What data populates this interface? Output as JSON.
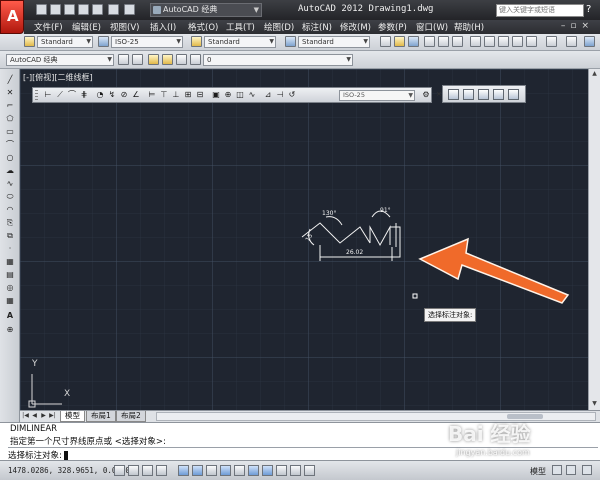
{
  "titlebar": {
    "workspace": "AutoCAD 经典",
    "app_title": "AutoCAD 2012   Drawing1.dwg",
    "search_placeholder": "键入关键字或短语"
  },
  "menu": [
    "文件(F)",
    "编辑(E)",
    "视图(V)",
    "插入(I)",
    "格式(O)",
    "工具(T)",
    "绘图(D)",
    "标注(N)",
    "修改(M)",
    "参数(P)",
    "窗口(W)",
    "帮助(H)"
  ],
  "toolbar_row1": {
    "text_style": "Standard",
    "dim_style": "ISO-25",
    "table_style": "Standard",
    "multileader_style": "Standard"
  },
  "toolbar_row2": {
    "workspace": "AutoCAD 经典",
    "layer": "0"
  },
  "viewport": {
    "label": "[-][俯视][二维线框]",
    "dimstyle_select": "ISO-25"
  },
  "drawing": {
    "dim_angle_left": "130°",
    "dim_angle_right": "91°",
    "dim_left_small": "15",
    "dim_linear": "26.02",
    "arrow_color": "#f06a2a"
  },
  "tooltip": "选择标注对象:",
  "ucs": {
    "y": "Y",
    "x": "X"
  },
  "tabs": [
    "模型",
    "布局1",
    "布局2"
  ],
  "command": {
    "line1": "DIMLINEAR",
    "line2": "指定第一个尺寸界线原点或 <选择对象>:",
    "line3": "选择标注对象:"
  },
  "status": {
    "coords": "1478.0286, 328.9651, 0.0000",
    "model": "模型"
  },
  "watermark": {
    "brand": "Bai 经验",
    "url": "jingyan.baidu.com"
  }
}
